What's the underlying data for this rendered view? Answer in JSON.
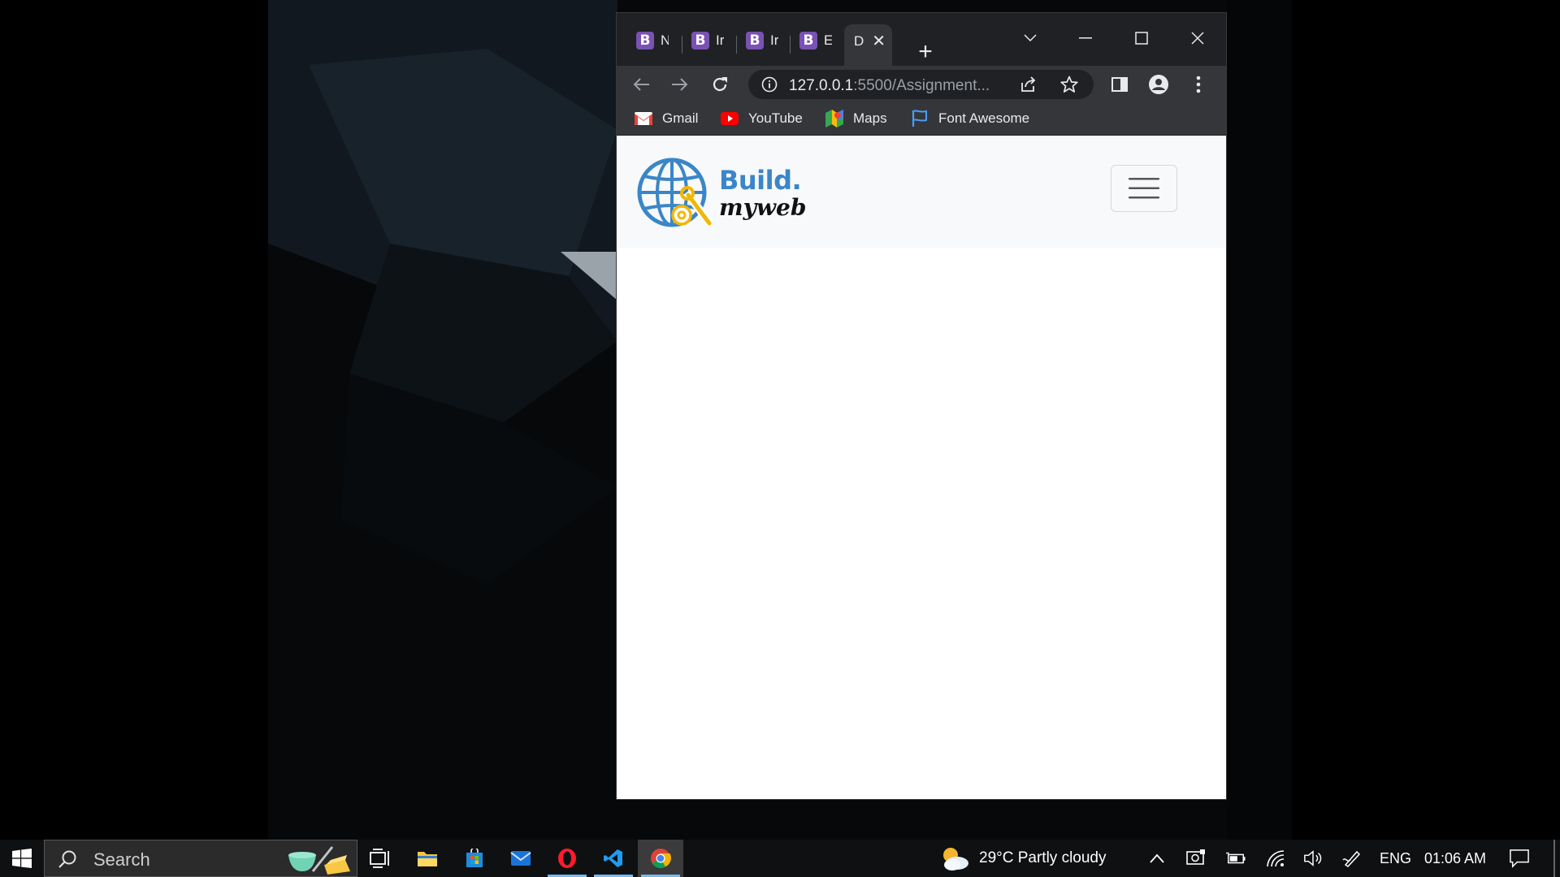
{
  "browser": {
    "tabs": [
      {
        "favicon": "B",
        "title": "N"
      },
      {
        "favicon": "B",
        "title": "Ir"
      },
      {
        "favicon": "B",
        "title": "Ir"
      },
      {
        "favicon": "B",
        "title": "E"
      }
    ],
    "active_tab": {
      "title": "D"
    },
    "address": {
      "host": "127.0.0.1",
      "rest": ":5500/Assignment..."
    },
    "bookmarks": [
      {
        "label": "Gmail",
        "icon": "gmail-icon"
      },
      {
        "label": "YouTube",
        "icon": "youtube-icon"
      },
      {
        "label": "Maps",
        "icon": "maps-icon"
      },
      {
        "label": "Font Awesome",
        "icon": "flag-icon"
      }
    ]
  },
  "page": {
    "brand_top": "Build.",
    "brand_bottom": "myweb"
  },
  "taskbar": {
    "search_label": "Search",
    "weather": "29°C  Partly cloudy",
    "language": "ENG",
    "clock": "01:06 AM"
  },
  "colors": {
    "bootstrap_purple": "#7952b3",
    "brand_blue": "#3a86c8",
    "brand_yellow": "#f2b705",
    "chrome_dark": "#202124"
  }
}
